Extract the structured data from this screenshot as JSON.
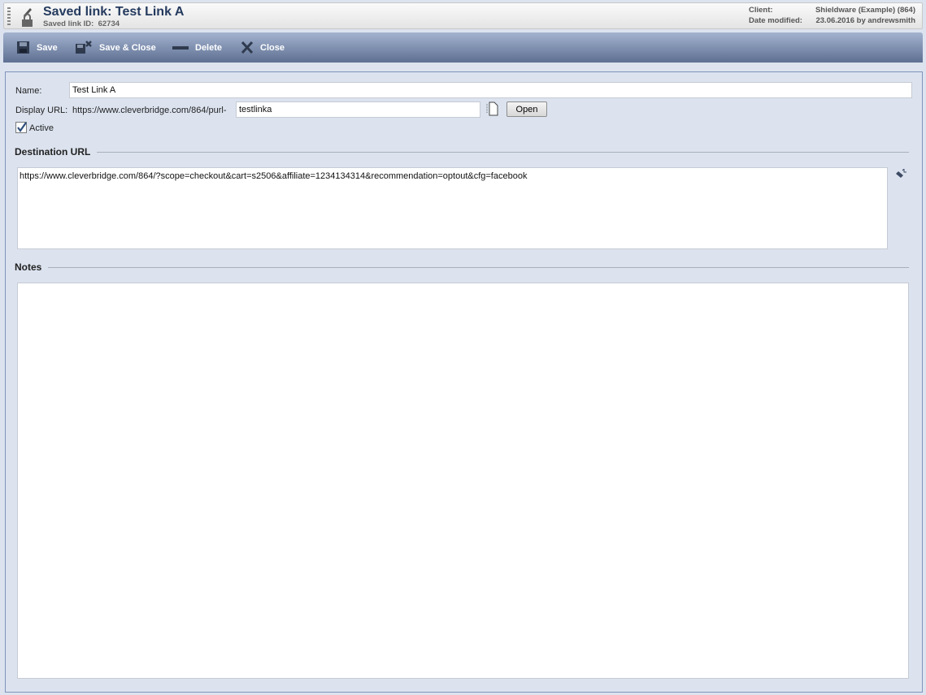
{
  "header": {
    "title": "Saved link:  Test Link A",
    "id_label": "Saved link ID:",
    "id_value": "62734",
    "client_label": "Client:",
    "client_value": "Shieldware (Example) (864)",
    "modified_label": "Date modified:",
    "modified_value": "23.06.2016 by andrewsmith"
  },
  "toolbar": {
    "save": "Save",
    "save_close": "Save & Close",
    "delete": "Delete",
    "close": "Close"
  },
  "form": {
    "name_label": "Name:",
    "name_value": "Test Link A",
    "display_url_label": "Display URL:",
    "display_url_prefix": "https://www.cleverbridge.com/864/purl-",
    "display_url_value": "testlinka",
    "open": "Open",
    "active_label": "Active",
    "active": true,
    "destination_heading": "Destination URL",
    "destination_value": "https://www.cleverbridge.com/864/?scope=checkout&cart=s2506&affiliate=1234134314&recommendation=optout&cfg=facebook",
    "notes_heading": "Notes",
    "notes_value": ""
  }
}
